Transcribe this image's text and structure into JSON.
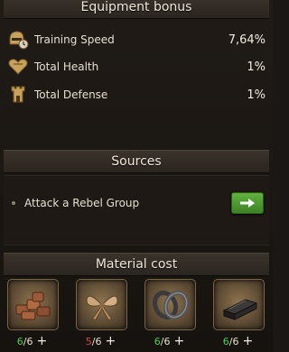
{
  "equipment": {
    "title": "Equipment bonus",
    "stats": [
      {
        "icon": "training-speed-icon",
        "label": "Training Speed",
        "value": "7,64%"
      },
      {
        "icon": "health-heart-icon",
        "label": "Total Health",
        "value": "1%"
      },
      {
        "icon": "defense-tower-icon",
        "label": "Total Defense",
        "value": "1%"
      }
    ]
  },
  "sources": {
    "title": "Sources",
    "items": [
      {
        "label": "Attack a Rebel Group",
        "action_icon": "arrow-right-icon"
      }
    ]
  },
  "materials": {
    "title": "Material cost",
    "items": [
      {
        "icon": "leather-pile-icon",
        "have": "6",
        "need": "/6",
        "status": "ok"
      },
      {
        "icon": "silk-ribbon-icon",
        "have": "5",
        "need": "/6",
        "status": "insufficient"
      },
      {
        "icon": "iron-rings-icon",
        "have": "6",
        "need": "/6",
        "status": "ok"
      },
      {
        "icon": "ebony-bar-icon",
        "have": "6",
        "need": "/6",
        "status": "ok"
      }
    ]
  },
  "colors": {
    "ok": "#4fcf4a",
    "insufficient": "#e0453f",
    "button": "#4f9c30"
  }
}
